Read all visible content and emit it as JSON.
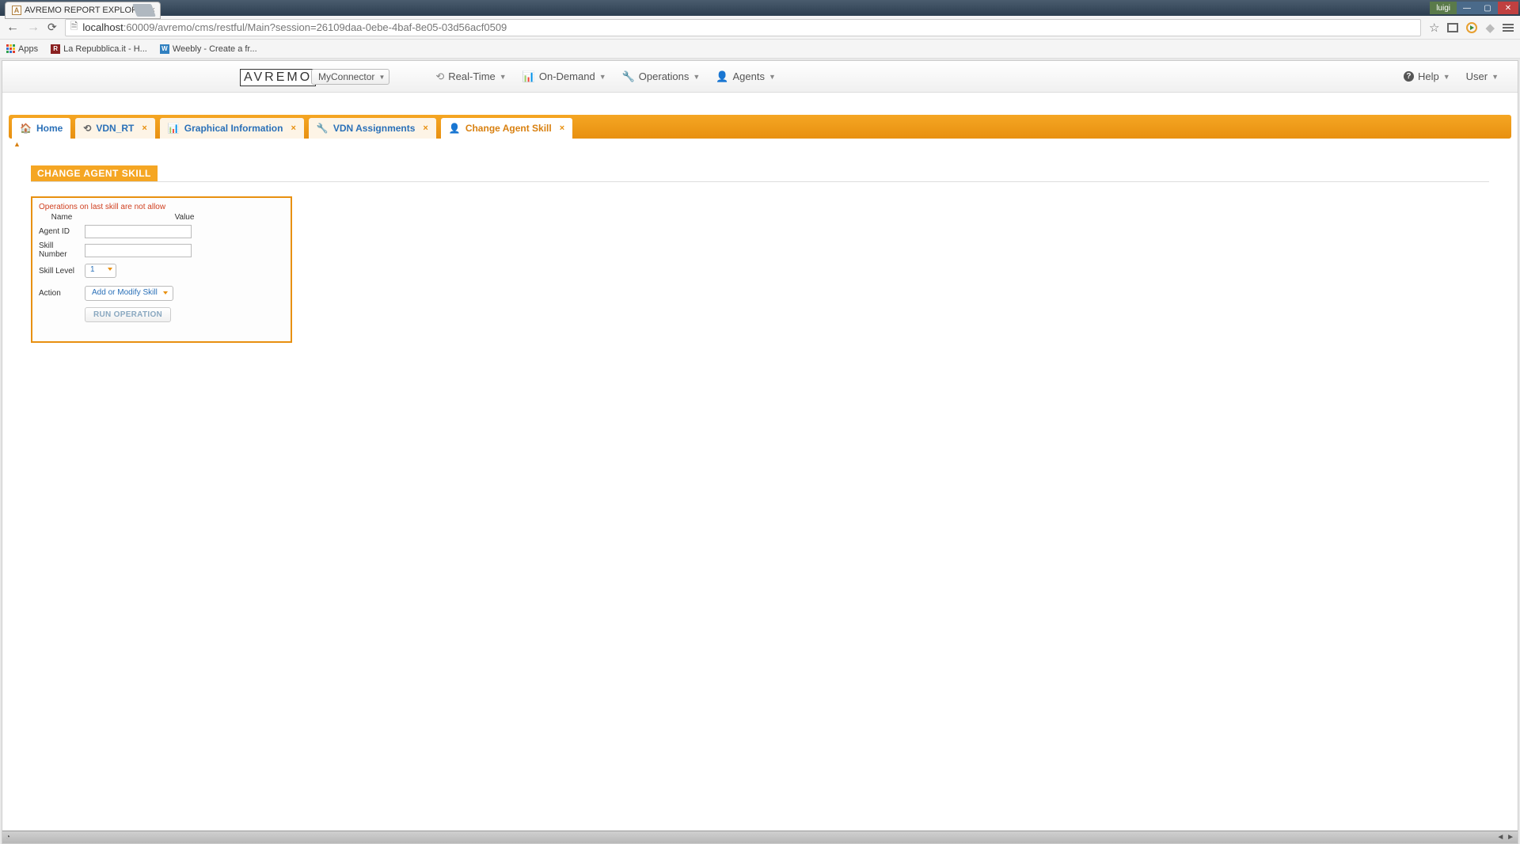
{
  "browser": {
    "tab_title": "AVREMO REPORT EXPLOR",
    "url_host": "localhost",
    "url_port_path": ":60009/avremo/cms/restful/Main?session=26109daa-0ebe-4baf-8e05-03d56acf0509",
    "win_user": "luigi",
    "bookmarks": {
      "apps": "Apps",
      "bm1": "La Repubblica.it - H...",
      "bm2": "Weebly - Create a fr..."
    }
  },
  "header": {
    "logo": "AVREMO",
    "connector": "MyConnector",
    "nav": {
      "realtime": "Real-Time",
      "ondemand": "On-Demand",
      "operations": "Operations",
      "agents": "Agents",
      "help": "Help",
      "user": "User"
    }
  },
  "tabs": {
    "home": "Home",
    "vdn_rt": "VDN_RT",
    "graphical": "Graphical Information",
    "vdn_assign": "VDN Assignments",
    "change_agent": "Change Agent Skill"
  },
  "section": {
    "title": "CHANGE AGENT SKILL"
  },
  "form": {
    "warning": "Operations on last skill are not allow",
    "col_name": "Name",
    "col_value": "Value",
    "agent_id_label": "Agent ID",
    "agent_id_value": "",
    "skill_number_label": "Skill Number",
    "skill_number_value": "",
    "skill_level_label": "Skill Level",
    "skill_level_value": "1",
    "action_label": "Action",
    "action_value": "Add or Modify Skill",
    "run_button": "RUN OPERATION"
  }
}
